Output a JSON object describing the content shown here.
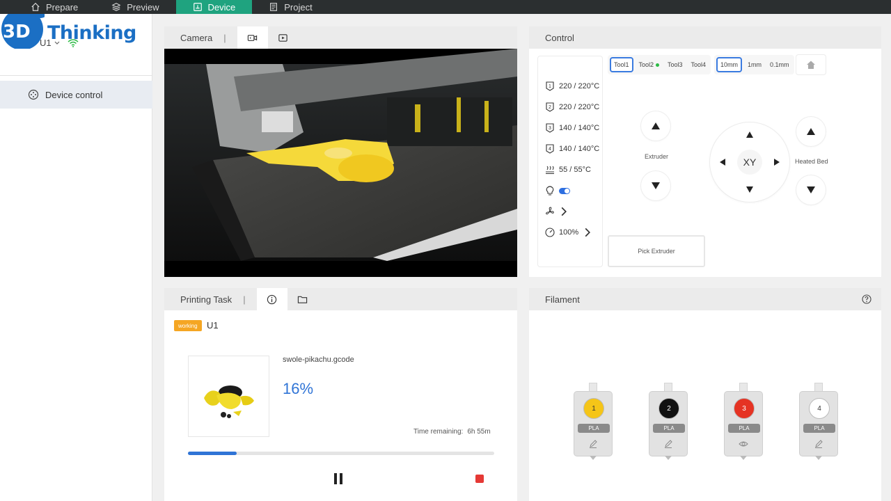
{
  "topbar": {
    "tabs": [
      {
        "label": "Prepare",
        "icon": "home-icon",
        "active": false
      },
      {
        "label": "Preview",
        "icon": "layers-icon",
        "active": false
      },
      {
        "label": "Device",
        "icon": "device-icon",
        "active": true
      },
      {
        "label": "Project",
        "icon": "project-icon",
        "active": false
      }
    ]
  },
  "sidebar": {
    "logo_text": "Thinking",
    "logo_mark": "3D",
    "device_name": "U1",
    "items": [
      {
        "label": "Device control",
        "icon": "device-control-icon"
      }
    ]
  },
  "camera": {
    "title": "Camera",
    "separator": "|"
  },
  "control": {
    "title": "Control",
    "temps": [
      {
        "icon": "nozzle-1-icon",
        "value": "220 / 220°C"
      },
      {
        "icon": "nozzle-2-icon",
        "value": "220 / 220°C"
      },
      {
        "icon": "nozzle-3-icon",
        "value": "140 / 140°C"
      },
      {
        "icon": "nozzle-4-icon",
        "value": "140 / 140°C"
      },
      {
        "icon": "bed-heat-icon",
        "value": "55 / 55°C"
      }
    ],
    "speed": "100%",
    "tools": [
      {
        "label": "Tool1",
        "selected": true,
        "active_dot": false
      },
      {
        "label": "Tool2",
        "selected": false,
        "active_dot": true
      },
      {
        "label": "Tool3",
        "selected": false,
        "active_dot": false
      },
      {
        "label": "Tool4",
        "selected": false,
        "active_dot": false
      }
    ],
    "steps": [
      {
        "label": "10mm",
        "selected": true
      },
      {
        "label": "1mm",
        "selected": false
      },
      {
        "label": "0.1mm",
        "selected": false
      }
    ],
    "extruder_label": "Extruder",
    "heated_bed_label": "Heated Bed",
    "xy_label": "XY",
    "pick_extruder_label": "Pick Extruder"
  },
  "task": {
    "title": "Printing Task",
    "separator": "|",
    "status_badge": "working",
    "device_name": "U1",
    "file_name": "swole-pikachu.gcode",
    "progress_text": "16%",
    "progress": 0.16,
    "time_remaining_label": "Time remaining:",
    "time_remaining_value": "6h 55m"
  },
  "filament": {
    "title": "Filament",
    "slots": [
      {
        "number": "1",
        "type": "PLA",
        "color": "#f5c518",
        "text_color": "#333333",
        "action_icon": "edit-icon"
      },
      {
        "number": "2",
        "type": "PLA",
        "color": "#111111",
        "text_color": "#ffffff",
        "action_icon": "edit-icon"
      },
      {
        "number": "3",
        "type": "PLA",
        "color": "#e53323",
        "text_color": "#ffffff",
        "action_icon": "eye-icon"
      },
      {
        "number": "4",
        "type": "PLA",
        "color": "#ffffff",
        "text_color": "#333333",
        "action_icon": "edit-icon"
      }
    ]
  },
  "colors": {
    "accent_green": "#1fa37f",
    "accent_blue": "#2f74d6",
    "badge_orange": "#f5a623",
    "stop_red": "#e53935"
  }
}
